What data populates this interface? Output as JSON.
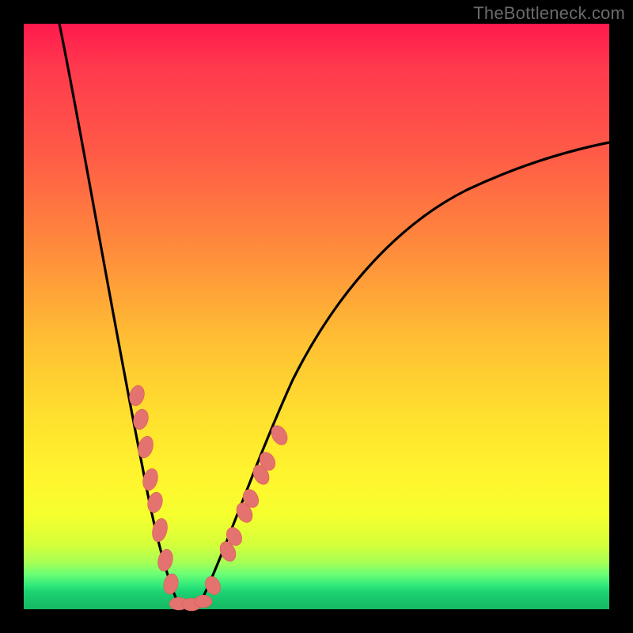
{
  "watermark": "TheBottleneck.com",
  "colors": {
    "frame_bg": "#000000",
    "curve": "#000000",
    "marker_fill": "#e4736f",
    "marker_stroke": "#d95a56",
    "gradient_top": "#ff1a4d",
    "gradient_bottom": "#16b964"
  },
  "chart_data": {
    "type": "line",
    "title": "",
    "xlabel": "",
    "ylabel": "",
    "xlim": [
      0,
      100
    ],
    "ylim": [
      0,
      100
    ],
    "grid": false,
    "legend": false,
    "series": [
      {
        "name": "bottleneck-curve",
        "note": "V-shaped absolute-deviation curve; y≈0 at the minimum near x≈27, rising steeply to the left edge (y≈100 at x≈6) and rising with decreasing slope toward the right edge (y≈77 at x=100). Values are read off the plotted silhouette in percent of the inner plot box.",
        "x": [
          6,
          8,
          10,
          12,
          14,
          16,
          18,
          20,
          21,
          22,
          23,
          24,
          25,
          26,
          27,
          28,
          29,
          30,
          31,
          32,
          33,
          34,
          35,
          37,
          40,
          45,
          50,
          55,
          60,
          65,
          70,
          75,
          80,
          85,
          90,
          95,
          100
        ],
        "y": [
          100,
          91,
          82,
          73,
          64,
          55,
          46,
          37,
          32,
          27,
          22,
          17,
          12,
          6,
          0,
          0,
          0,
          1,
          2,
          4,
          7,
          10,
          13,
          18,
          24,
          32,
          39,
          45,
          50,
          55,
          59,
          63,
          66,
          69,
          72,
          75,
          77
        ]
      }
    ],
    "markers": {
      "note": "salmon lozenge markers clustered around the valley on both arms (approx y 5–35% band)",
      "left_arm": [
        {
          "x": 18.5,
          "y": 41
        },
        {
          "x": 19.3,
          "y": 36
        },
        {
          "x": 20.0,
          "y": 32
        },
        {
          "x": 20.5,
          "y": 29
        },
        {
          "x": 21.6,
          "y": 23
        },
        {
          "x": 22.2,
          "y": 20
        },
        {
          "x": 22.8,
          "y": 17
        },
        {
          "x": 23.7,
          "y": 12
        },
        {
          "x": 24.3,
          "y": 9
        },
        {
          "x": 25.2,
          "y": 5
        }
      ],
      "right_arm": [
        {
          "x": 29.5,
          "y": 2
        },
        {
          "x": 31.0,
          "y": 4
        },
        {
          "x": 33.7,
          "y": 11
        },
        {
          "x": 34.3,
          "y": 13
        },
        {
          "x": 35.7,
          "y": 17
        },
        {
          "x": 36.4,
          "y": 19
        },
        {
          "x": 37.8,
          "y": 23
        },
        {
          "x": 38.4,
          "y": 25
        },
        {
          "x": 40.3,
          "y": 31
        }
      ],
      "bottom": [
        {
          "x": 26.0,
          "y": 0.5
        },
        {
          "x": 27.2,
          "y": 0.5
        },
        {
          "x": 28.3,
          "y": 0.5
        }
      ]
    }
  }
}
